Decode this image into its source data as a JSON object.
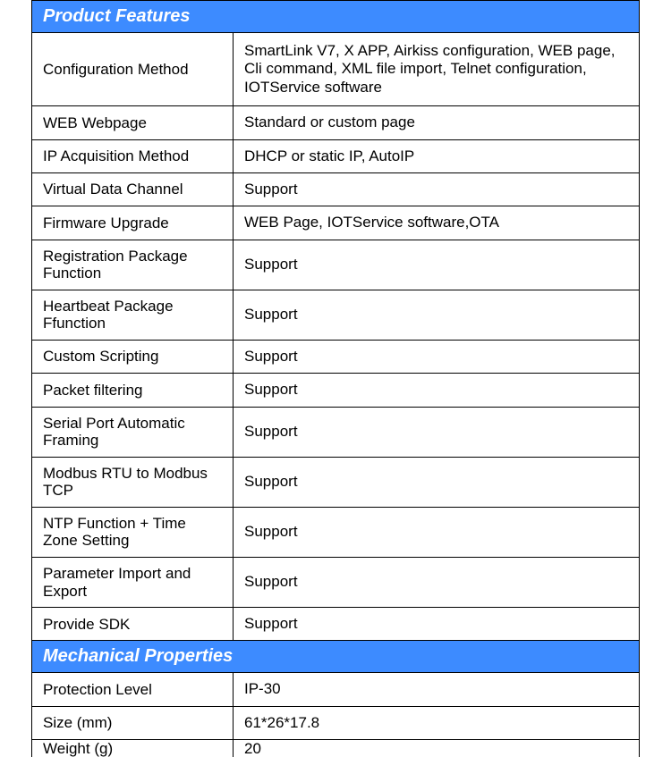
{
  "sections": [
    {
      "title": "Product Features",
      "rows": [
        {
          "label": "Configuration Method",
          "value": "SmartLink V7, X APP, Airkiss configuration, WEB page, Cli command, XML file import, Telnet configuration, IOTService software",
          "tall": true
        },
        {
          "label": "WEB Webpage",
          "value": "Standard or custom page"
        },
        {
          "label": "IP Acquisition Method",
          "value": "DHCP or static IP, AutoIP"
        },
        {
          "label": "Virtual Data Channel",
          "value": "Support"
        },
        {
          "label": "Firmware Upgrade",
          "value": "WEB Page, IOTService software,OTA"
        },
        {
          "label": "Registration Package Function",
          "value": "Support"
        },
        {
          "label": "Heartbeat Package Ffunction",
          "value": "Support"
        },
        {
          "label": "Custom Scripting",
          "value": "Support"
        },
        {
          "label": "Packet filtering",
          "value": "Support"
        },
        {
          "label": "Serial Port Automatic Framing",
          "value": "Support"
        },
        {
          "label": "Modbus RTU to Modbus TCP",
          "value": "Support"
        },
        {
          "label": "NTP Function + Time Zone Setting",
          "value": "Support"
        },
        {
          "label": "Parameter Import and Export",
          "value": "Support"
        },
        {
          "label": "Provide SDK",
          "value": "Support"
        }
      ]
    },
    {
      "title": "Mechanical Properties",
      "rows": [
        {
          "label": "Protection Level",
          "value": "IP-30"
        },
        {
          "label": "Size (mm)",
          "value": "61*26*17.8"
        },
        {
          "label": "Weight (g)",
          "value": "20",
          "cutoff": true
        }
      ]
    }
  ]
}
